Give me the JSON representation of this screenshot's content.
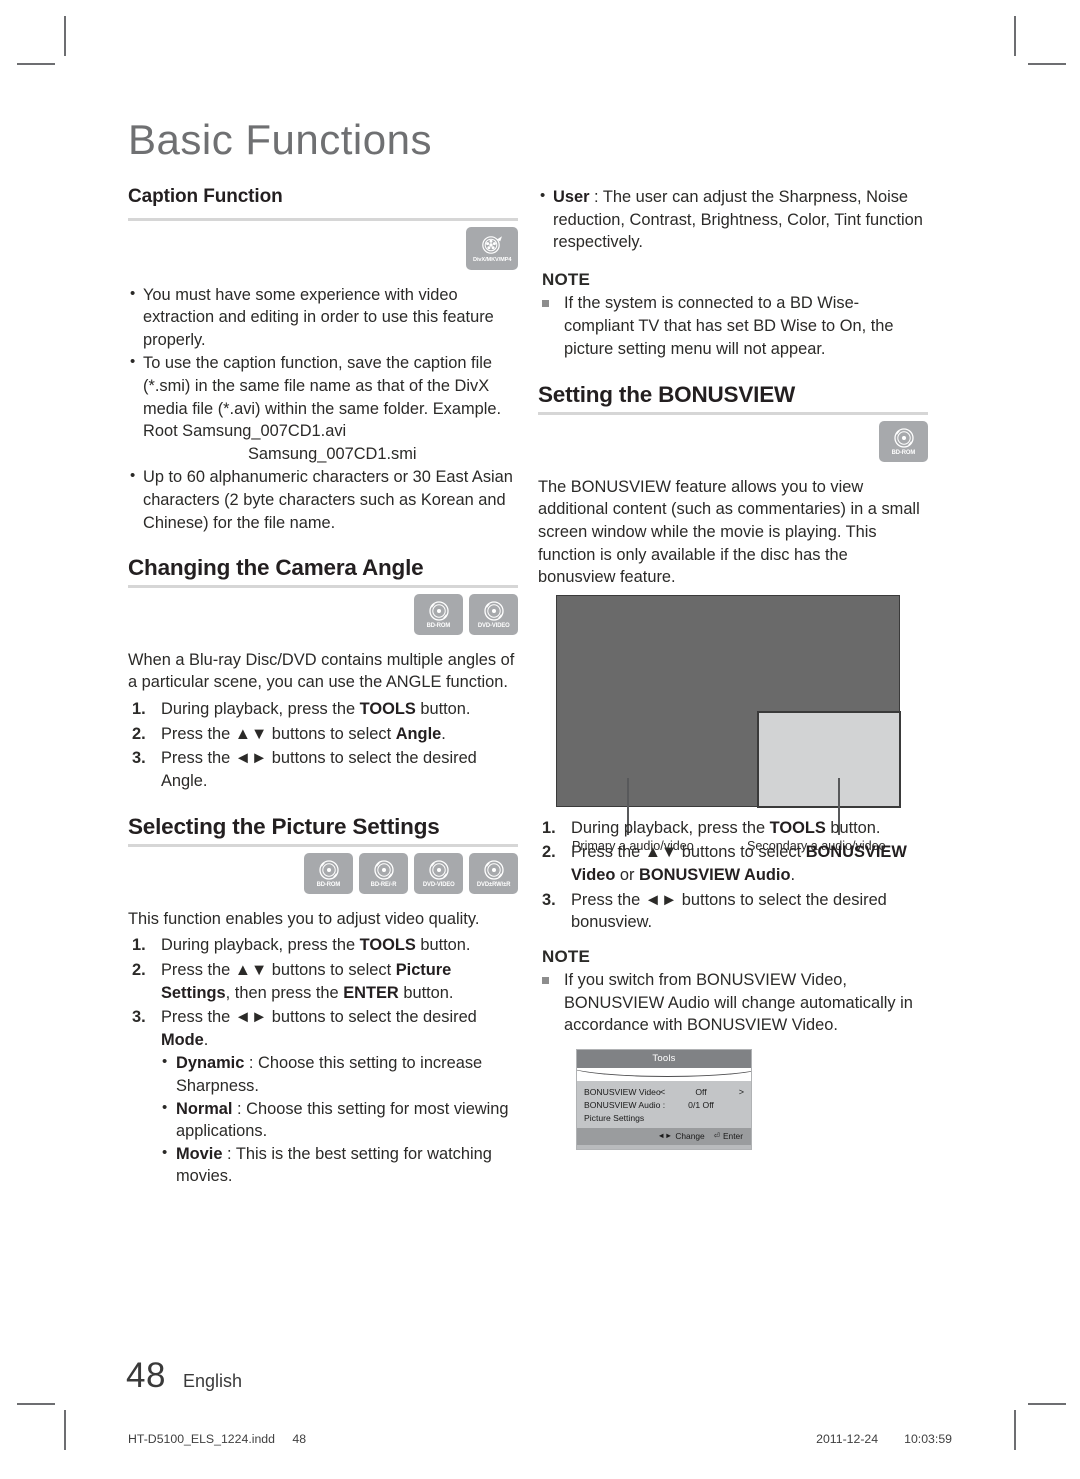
{
  "page": {
    "chapter_title": "Basic Functions",
    "folio_number": "48",
    "folio_language": "English",
    "production": {
      "filename": "HT-D5100_ELS_1224.indd",
      "indd_page": "48",
      "date": "2011-12-24",
      "time": "10:03:59"
    }
  },
  "left_column": {
    "caption_function": {
      "heading": "Caption Function",
      "icons": [
        {
          "name": "divx-mkv-mp4",
          "caption": "DivX/MKV/MP4"
        }
      ],
      "bullets": [
        "You must have some experience with video extraction and editing in order to use this feature properly.",
        "To use the caption function, save the caption file (*.smi) in the same file name as that of the DivX media file (*.avi) within the same folder.",
        "Up to 60 alphanumeric characters or 30 East Asian characters (2 byte characters such as Korean and Chinese) for the file name."
      ],
      "example_label": "Example. Root Samsung_007CD1.avi",
      "example_second": "Samsung_007CD1.smi"
    },
    "camera_angle": {
      "heading": "Changing the Camera Angle",
      "icons": [
        {
          "name": "bd-rom",
          "caption": "BD-ROM"
        },
        {
          "name": "dvd-video",
          "caption": "DVD-VIDEO"
        }
      ],
      "intro": "When a Blu-ray Disc/DVD contains multiple angles of a particular scene, you can use the ANGLE function.",
      "steps": [
        {
          "num": "1.",
          "pre": "During playback, press the ",
          "bold": "TOOLS",
          "post": " button."
        },
        {
          "num": "2.",
          "pre": "Press the ▲▼ buttons to select ",
          "bold": "Angle",
          "post": "."
        },
        {
          "num": "3.",
          "pre": "Press the ◄► buttons to select the desired Angle.",
          "bold": "",
          "post": ""
        }
      ]
    },
    "picture_settings": {
      "heading": "Selecting the Picture Settings",
      "icons": [
        {
          "name": "bd-rom",
          "caption": "BD-ROM"
        },
        {
          "name": "bd-re-r",
          "caption": "BD-RE/-R"
        },
        {
          "name": "dvd-video",
          "caption": "DVD-VIDEO"
        },
        {
          "name": "dvd-rw-r",
          "caption": "DVD±RW/±R"
        }
      ],
      "intro": "This function enables you to adjust video quality.",
      "step1": {
        "num": "1.",
        "pre": "During playback, press the ",
        "bold": "TOOLS",
        "post": " button."
      },
      "step2": {
        "num": "2.",
        "pre": "Press the ▲▼ buttons to select ",
        "bold1": "Picture Settings",
        "mid": ", then press the ",
        "bold2": "ENTER",
        "post": " button."
      },
      "step3": {
        "num": "3.",
        "pre": "Press the ◄► buttons to select the desired ",
        "bold": "Mode",
        "post": "."
      },
      "modes": [
        {
          "name": "Dynamic",
          "sep": " : ",
          "text": "Choose this setting to increase Sharpness."
        },
        {
          "name": "Normal",
          "sep": " : ",
          "text": "Choose this setting for most viewing applications."
        },
        {
          "name": "Movie",
          "sep": " : ",
          "text": "This is the best setting for watching movies."
        }
      ]
    }
  },
  "right_column": {
    "user_mode": {
      "name": "User",
      "sep": " : ",
      "text": "The user can adjust the Sharpness, Noise reduction, Contrast, Brightness, Color, Tint function respectively."
    },
    "note_picture": {
      "title": "NOTE",
      "items": [
        "If the system is connected to a BD Wise-compliant TV that has set BD Wise to On, the picture setting menu will not appear."
      ]
    },
    "bonusview": {
      "heading": "Setting the BONUSVIEW",
      "icons": [
        {
          "name": "bd-rom",
          "caption": "BD-ROM"
        }
      ],
      "intro": "The BONUSVIEW feature allows you to view additional content (such as commentaries) in a small screen window while the movie is playing. This function is only available if the disc has the bonusview feature.",
      "diagram": {
        "primary_label": "Primary a audio/video",
        "secondary_label": "Secondary a audio/video",
        "primary_color": "#6a6a6a",
        "secondary_color": "#d2d3d4"
      },
      "steps": [
        {
          "num": "1.",
          "pre": "During playback, press the ",
          "bold": "TOOLS",
          "post": " button."
        },
        {
          "num": "2.",
          "pre": "Press the ▲▼ buttons to select ",
          "bold1": "BONUSVIEW Video",
          "mid": " or ",
          "bold2": "BONUSVIEW Audio",
          "post": "."
        },
        {
          "num": "3.",
          "pre": "Press the ◄► buttons to select the desired bonusview.",
          "bold": "",
          "post": ""
        }
      ],
      "note": {
        "title": "NOTE",
        "items": [
          "If you switch from BONUSVIEW Video, BONUSVIEW Audio will change automatically in accordance with BONUSVIEW Video."
        ]
      },
      "osd": {
        "title": "Tools",
        "rows": [
          {
            "label": "BONUSVIEW Video",
            "marker": "<",
            "value": "Off",
            "arrow": ">"
          },
          {
            "label": "BONUSVIEW Audio :",
            "marker": "",
            "value": "0/1 Off",
            "arrow": ""
          },
          {
            "label": "Picture Settings",
            "marker": "",
            "value": "",
            "arrow": ""
          }
        ],
        "footer": {
          "change_icon": "◄►",
          "change_label": "Change",
          "enter_icon": "⏎",
          "enter_label": "Enter"
        }
      }
    }
  }
}
